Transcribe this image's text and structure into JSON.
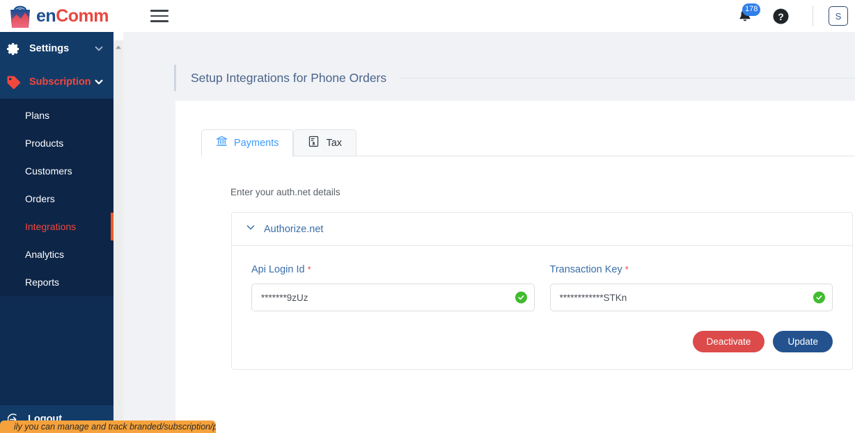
{
  "header": {
    "logo": {
      "part1": "en",
      "part2": "C",
      "part3": "omm",
      "icon": "shopping-bag-logo"
    },
    "menu_toggle": "hamburger-menu",
    "notifications": {
      "icon": "bell-icon",
      "count": "178"
    },
    "help": {
      "icon": "help-circle-icon"
    },
    "avatar": {
      "initial": "S"
    }
  },
  "sidebar": {
    "groups": [
      {
        "label": "Settings",
        "icon": "gear-icon",
        "active": false,
        "expanded": true
      },
      {
        "label": "Subscription",
        "icon": "tag-icon",
        "active": true,
        "expanded": true
      }
    ],
    "items": [
      {
        "label": "Plans",
        "active": false
      },
      {
        "label": "Products",
        "active": false
      },
      {
        "label": "Customers",
        "active": false
      },
      {
        "label": "Orders",
        "active": false
      },
      {
        "label": "Integrations",
        "active": true
      },
      {
        "label": "Analytics",
        "active": false
      },
      {
        "label": "Reports",
        "active": false
      }
    ],
    "logout": {
      "label": "Logout",
      "icon": "logout-arrow-icon"
    }
  },
  "main": {
    "page_title": "Setup Integrations for Phone Orders",
    "tabs": [
      {
        "label": "Payments",
        "icon": "bank-icon",
        "active": true
      },
      {
        "label": "Tax",
        "icon": "tax-document-icon",
        "active": false
      }
    ],
    "form_caption": "Enter your auth.net details",
    "accordion": {
      "title": "Authorize.net",
      "chevron": "chevron-down-icon",
      "fields": [
        {
          "label": "Api Login Id",
          "required": "*",
          "value": "*******9zUz",
          "placeholder": "Api Login Id",
          "valid_icon": "check-circle-icon"
        },
        {
          "label": "Transaction Key",
          "required": "*",
          "value": "************STKn",
          "placeholder": "Transaction Key",
          "valid_icon": "check-circle-icon"
        }
      ],
      "buttons": {
        "deactivate": "Deactivate",
        "update": "Update"
      }
    }
  },
  "toast": {
    "text": "ily you can manage and track branded/subscription/payments"
  },
  "colors": {
    "sidebar_bg": "#0e2b52",
    "sidebar_group_bg": "#133b68",
    "accent_red": "#f0483e",
    "accent_orange": "#f15a22",
    "link_blue": "#3a6ea8",
    "tab_active_blue": "#3d9bfd",
    "btn_danger": "#dc4a4a",
    "btn_primary": "#23528f",
    "success_green": "#41bb2f",
    "badge_blue": "#2f7fe8",
    "toast_orange": "#f5a23c"
  }
}
